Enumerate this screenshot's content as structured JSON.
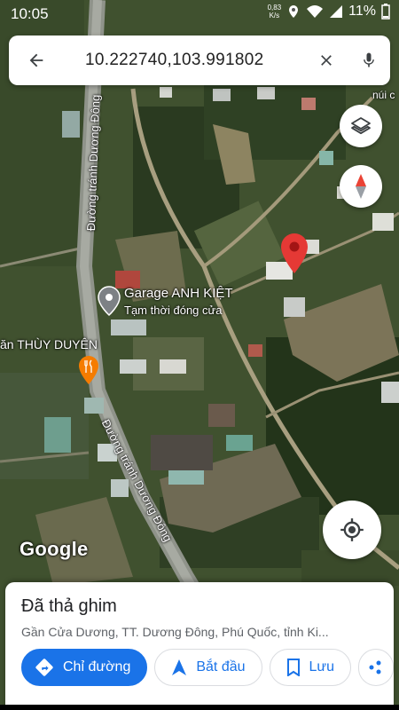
{
  "status_bar": {
    "time": "10:05",
    "speed_value": "0,83",
    "speed_unit": "K/s",
    "battery": "11%"
  },
  "search": {
    "query": "10.222740,103.991802",
    "back_icon": "arrow-back-icon",
    "clear_icon": "close-icon",
    "mic_icon": "microphone-icon"
  },
  "map": {
    "road_label_north": "Đường tránh Dương Đông",
    "road_label_south": "Đường tránh Dương Đông",
    "poi_garage_name": "Garage ANH KIỆT",
    "poi_garage_status": "Tạm thời đóng cửa",
    "poi_restaurant_name": "ăn THÙY DUYÊN",
    "poi_edge_label": "núi c",
    "attribution": "Google",
    "pin_color": "#e53935"
  },
  "bottom_sheet": {
    "title": "Đã thả ghim",
    "address": "Gần Cửa Dương, TT. Dương Đông, Phú Quốc, tỉnh Ki...",
    "directions_label": "Chỉ đường",
    "start_label": "Bắt đầu",
    "save_label": "Lưu",
    "accent": "#1a73e8"
  }
}
